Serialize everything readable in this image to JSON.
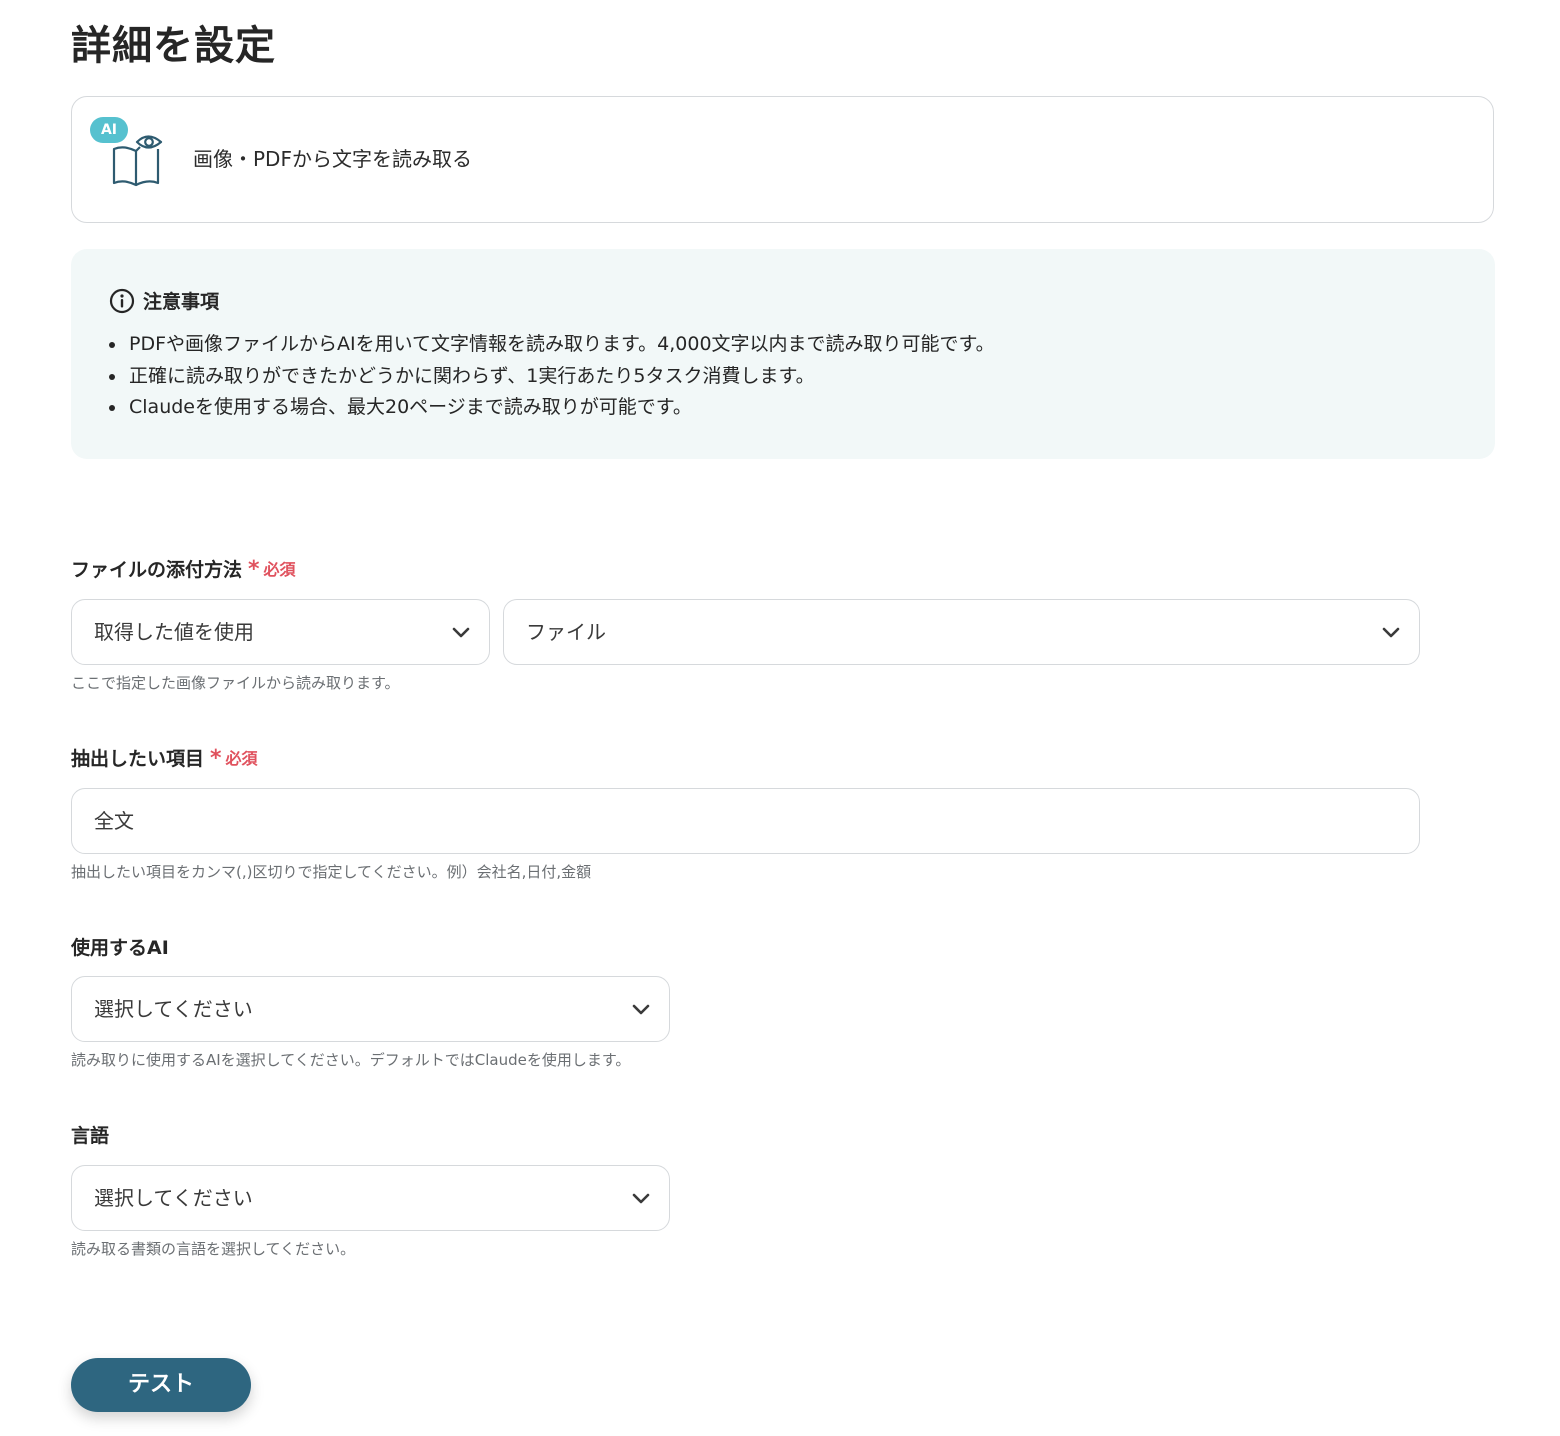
{
  "page": {
    "title": "詳細を設定"
  },
  "action": {
    "badge": "AI",
    "label": "画像・PDFから文字を読み取る",
    "icon": "book-eye-icon"
  },
  "notice": {
    "icon": "info-icon",
    "title": "注意事項",
    "items": [
      "PDFや画像ファイルからAIを用いて文字情報を読み取ります。4,000文字以内まで読み取り可能です。",
      "正確に読み取りができたかどうかに関わらず、1実行あたり5タスク消費します。",
      "Claudeを使用する場合、最大20ページまで読み取りが可能です。"
    ]
  },
  "fields": {
    "attach": {
      "label": "ファイルの添付方法",
      "required_star": "*",
      "required_text": "必須",
      "method_value": "取得した値を使用",
      "file_value": "ファイル",
      "help": "ここで指定した画像ファイルから読み取ります。"
    },
    "extract": {
      "label": "抽出したい項目",
      "required_star": "*",
      "required_text": "必須",
      "value": "全文",
      "help": "抽出したい項目をカンマ(,)区切りで指定してください。例）会社名,日付,金額"
    },
    "ai": {
      "label": "使用するAI",
      "value": "選択してください",
      "help": "読み取りに使用するAIを選択してください。デフォルトではClaudeを使用します。"
    },
    "language": {
      "label": "言語",
      "value": "選択してください",
      "help": "読み取る書類の言語を選択してください。"
    }
  },
  "buttons": {
    "test": "テスト"
  },
  "colors": {
    "accent_badge": "#56c1cf",
    "required": "#e0525e",
    "button": "#2e6680",
    "notice_bg": "#f2f8f8"
  }
}
